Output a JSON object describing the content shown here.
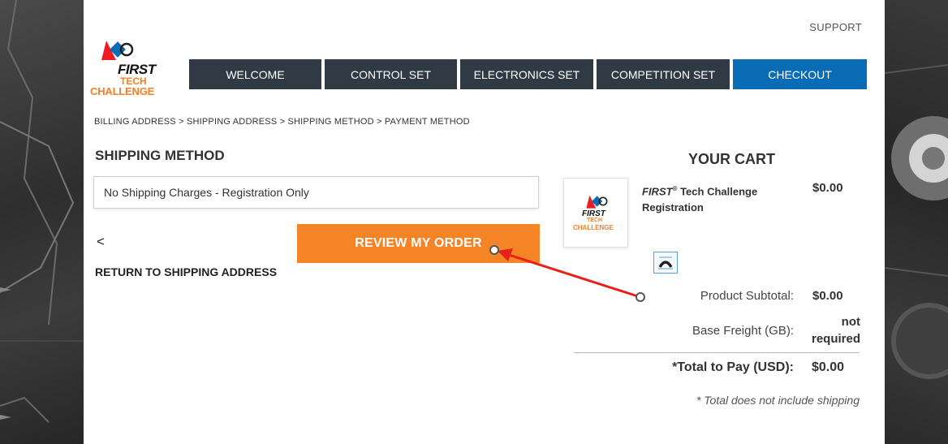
{
  "header": {
    "support_label": "SUPPORT",
    "logo": {
      "line1": "FIRST",
      "line2": "TECH",
      "line3": "CHALLENGE"
    }
  },
  "nav": {
    "items": [
      {
        "label": "WELCOME"
      },
      {
        "label": "CONTROL SET"
      },
      {
        "label": "ELECTRONICS SET"
      },
      {
        "label": "COMPETITION SET"
      },
      {
        "label": "CHECKOUT",
        "active": true
      }
    ]
  },
  "breadcrumb": "BILLING ADDRESS > SHIPPING ADDRESS > SHIPPING METHOD > PAYMENT METHOD",
  "shipping": {
    "heading": "SHIPPING METHOD",
    "selected_option": "No Shipping Charges - Registration Only",
    "back_chevron": "<",
    "back_label": "RETURN TO SHIPPING ADDRESS",
    "review_button": "REVIEW MY ORDER"
  },
  "cart": {
    "heading": "YOUR CART",
    "item": {
      "name_italic": "FIRST",
      "name_sup": "®",
      "name_rest": " Tech Challenge Registration",
      "price": "$0.00",
      "thumb_line1": "FIRST",
      "thumb_line2": "TECH",
      "thumb_line3": "CHALLENGE"
    },
    "subtotal_label": "Product Subtotal:",
    "subtotal_value": "$0.00",
    "freight_label": "Base Freight (GB):",
    "freight_value_line1": "not",
    "freight_value_line2": "required",
    "total_label": "*Total to Pay (USD):",
    "total_value": "$0.00",
    "note": "* Total does not include shipping"
  },
  "colors": {
    "nav_bg": "#2f3a45",
    "nav_active": "#0a6cb5",
    "accent_orange": "#f58426",
    "annotation_arrow": "#e8201a"
  }
}
